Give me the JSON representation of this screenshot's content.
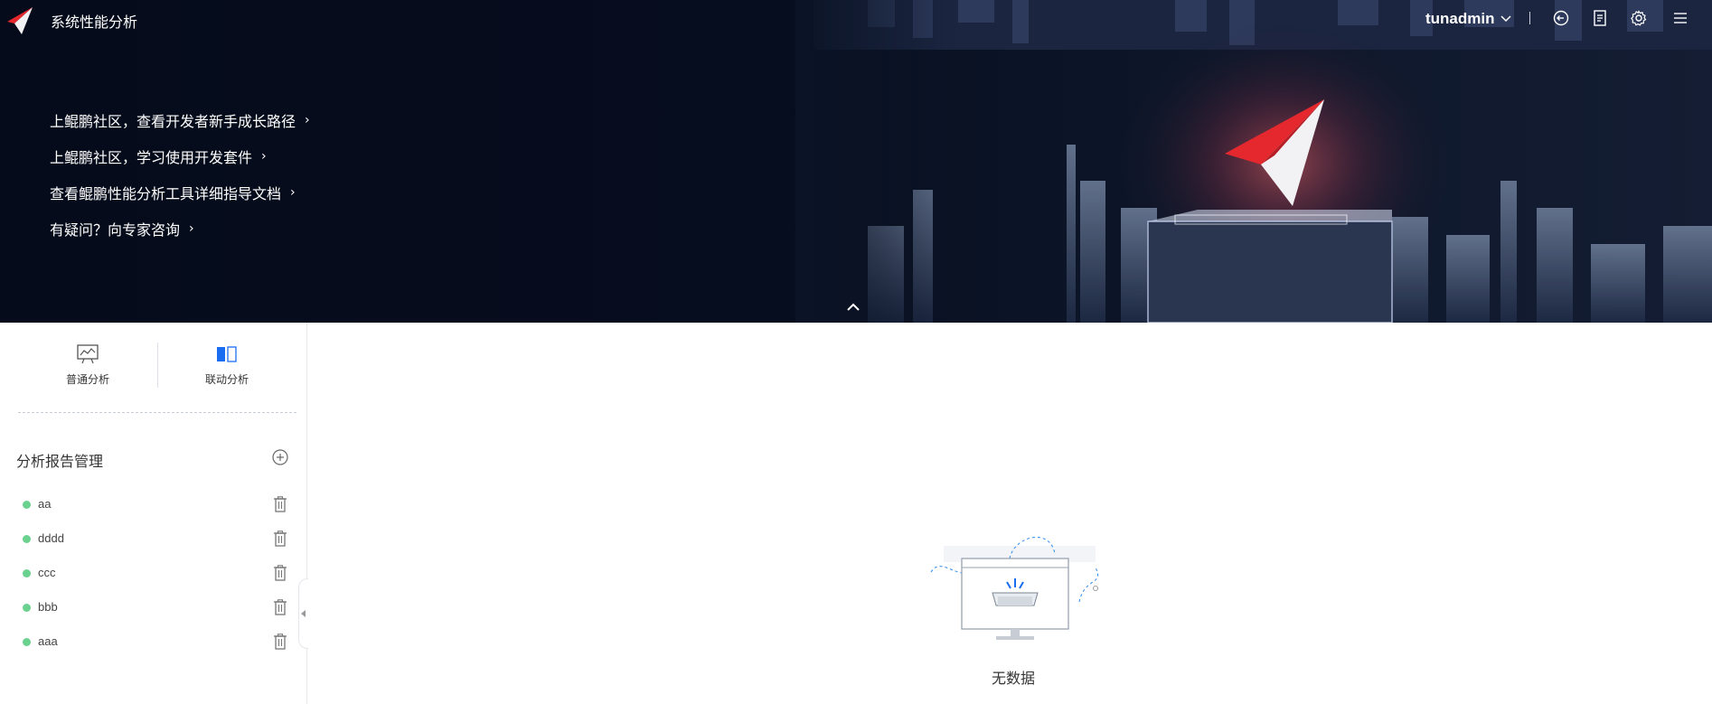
{
  "header": {
    "app_title": "系统性能分析",
    "user_name": "tunadmin",
    "icons": [
      "logout-icon",
      "document-icon",
      "settings-icon",
      "menu-icon"
    ]
  },
  "hero": {
    "links": [
      {
        "label": "上鲲鹏社区，查看开发者新手成长路径"
      },
      {
        "label": "上鲲鹏社区，学习使用开发套件"
      },
      {
        "label": "查看鲲鹏性能分析工具详细指导文档"
      },
      {
        "label": "有疑问？向专家咨询"
      }
    ],
    "link_chevron": "›"
  },
  "sidebar": {
    "tabs": [
      {
        "label": "普通分析",
        "active": false
      },
      {
        "label": "联动分析",
        "active": true
      }
    ],
    "section_title": "分析报告管理",
    "reports": [
      {
        "name": "aa",
        "status_color": "#6ad18f"
      },
      {
        "name": "dddd",
        "status_color": "#6ad18f"
      },
      {
        "name": "ccc",
        "status_color": "#6ad18f"
      },
      {
        "name": "bbb",
        "status_color": "#6ad18f"
      },
      {
        "name": "aaa",
        "status_color": "#6ad18f"
      }
    ]
  },
  "main": {
    "empty_text": "无数据"
  },
  "colors": {
    "accent": "#1a6cf0",
    "brand_red": "#d9262c",
    "status_green": "#6ad18f",
    "hero_bg": "#050b1a"
  }
}
